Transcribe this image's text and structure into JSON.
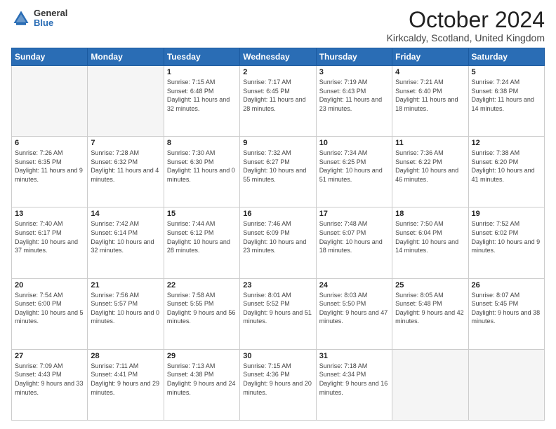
{
  "header": {
    "logo_general": "General",
    "logo_blue": "Blue",
    "title": "October 2024",
    "location": "Kirkcaldy, Scotland, United Kingdom"
  },
  "weekdays": [
    "Sunday",
    "Monday",
    "Tuesday",
    "Wednesday",
    "Thursday",
    "Friday",
    "Saturday"
  ],
  "weeks": [
    [
      {
        "day": "",
        "sunrise": "",
        "sunset": "",
        "daylight": ""
      },
      {
        "day": "",
        "sunrise": "",
        "sunset": "",
        "daylight": ""
      },
      {
        "day": "1",
        "sunrise": "Sunrise: 7:15 AM",
        "sunset": "Sunset: 6:48 PM",
        "daylight": "Daylight: 11 hours and 32 minutes."
      },
      {
        "day": "2",
        "sunrise": "Sunrise: 7:17 AM",
        "sunset": "Sunset: 6:45 PM",
        "daylight": "Daylight: 11 hours and 28 minutes."
      },
      {
        "day": "3",
        "sunrise": "Sunrise: 7:19 AM",
        "sunset": "Sunset: 6:43 PM",
        "daylight": "Daylight: 11 hours and 23 minutes."
      },
      {
        "day": "4",
        "sunrise": "Sunrise: 7:21 AM",
        "sunset": "Sunset: 6:40 PM",
        "daylight": "Daylight: 11 hours and 18 minutes."
      },
      {
        "day": "5",
        "sunrise": "Sunrise: 7:24 AM",
        "sunset": "Sunset: 6:38 PM",
        "daylight": "Daylight: 11 hours and 14 minutes."
      }
    ],
    [
      {
        "day": "6",
        "sunrise": "Sunrise: 7:26 AM",
        "sunset": "Sunset: 6:35 PM",
        "daylight": "Daylight: 11 hours and 9 minutes."
      },
      {
        "day": "7",
        "sunrise": "Sunrise: 7:28 AM",
        "sunset": "Sunset: 6:32 PM",
        "daylight": "Daylight: 11 hours and 4 minutes."
      },
      {
        "day": "8",
        "sunrise": "Sunrise: 7:30 AM",
        "sunset": "Sunset: 6:30 PM",
        "daylight": "Daylight: 11 hours and 0 minutes."
      },
      {
        "day": "9",
        "sunrise": "Sunrise: 7:32 AM",
        "sunset": "Sunset: 6:27 PM",
        "daylight": "Daylight: 10 hours and 55 minutes."
      },
      {
        "day": "10",
        "sunrise": "Sunrise: 7:34 AM",
        "sunset": "Sunset: 6:25 PM",
        "daylight": "Daylight: 10 hours and 51 minutes."
      },
      {
        "day": "11",
        "sunrise": "Sunrise: 7:36 AM",
        "sunset": "Sunset: 6:22 PM",
        "daylight": "Daylight: 10 hours and 46 minutes."
      },
      {
        "day": "12",
        "sunrise": "Sunrise: 7:38 AM",
        "sunset": "Sunset: 6:20 PM",
        "daylight": "Daylight: 10 hours and 41 minutes."
      }
    ],
    [
      {
        "day": "13",
        "sunrise": "Sunrise: 7:40 AM",
        "sunset": "Sunset: 6:17 PM",
        "daylight": "Daylight: 10 hours and 37 minutes."
      },
      {
        "day": "14",
        "sunrise": "Sunrise: 7:42 AM",
        "sunset": "Sunset: 6:14 PM",
        "daylight": "Daylight: 10 hours and 32 minutes."
      },
      {
        "day": "15",
        "sunrise": "Sunrise: 7:44 AM",
        "sunset": "Sunset: 6:12 PM",
        "daylight": "Daylight: 10 hours and 28 minutes."
      },
      {
        "day": "16",
        "sunrise": "Sunrise: 7:46 AM",
        "sunset": "Sunset: 6:09 PM",
        "daylight": "Daylight: 10 hours and 23 minutes."
      },
      {
        "day": "17",
        "sunrise": "Sunrise: 7:48 AM",
        "sunset": "Sunset: 6:07 PM",
        "daylight": "Daylight: 10 hours and 18 minutes."
      },
      {
        "day": "18",
        "sunrise": "Sunrise: 7:50 AM",
        "sunset": "Sunset: 6:04 PM",
        "daylight": "Daylight: 10 hours and 14 minutes."
      },
      {
        "day": "19",
        "sunrise": "Sunrise: 7:52 AM",
        "sunset": "Sunset: 6:02 PM",
        "daylight": "Daylight: 10 hours and 9 minutes."
      }
    ],
    [
      {
        "day": "20",
        "sunrise": "Sunrise: 7:54 AM",
        "sunset": "Sunset: 6:00 PM",
        "daylight": "Daylight: 10 hours and 5 minutes."
      },
      {
        "day": "21",
        "sunrise": "Sunrise: 7:56 AM",
        "sunset": "Sunset: 5:57 PM",
        "daylight": "Daylight: 10 hours and 0 minutes."
      },
      {
        "day": "22",
        "sunrise": "Sunrise: 7:58 AM",
        "sunset": "Sunset: 5:55 PM",
        "daylight": "Daylight: 9 hours and 56 minutes."
      },
      {
        "day": "23",
        "sunrise": "Sunrise: 8:01 AM",
        "sunset": "Sunset: 5:52 PM",
        "daylight": "Daylight: 9 hours and 51 minutes."
      },
      {
        "day": "24",
        "sunrise": "Sunrise: 8:03 AM",
        "sunset": "Sunset: 5:50 PM",
        "daylight": "Daylight: 9 hours and 47 minutes."
      },
      {
        "day": "25",
        "sunrise": "Sunrise: 8:05 AM",
        "sunset": "Sunset: 5:48 PM",
        "daylight": "Daylight: 9 hours and 42 minutes."
      },
      {
        "day": "26",
        "sunrise": "Sunrise: 8:07 AM",
        "sunset": "Sunset: 5:45 PM",
        "daylight": "Daylight: 9 hours and 38 minutes."
      }
    ],
    [
      {
        "day": "27",
        "sunrise": "Sunrise: 7:09 AM",
        "sunset": "Sunset: 4:43 PM",
        "daylight": "Daylight: 9 hours and 33 minutes."
      },
      {
        "day": "28",
        "sunrise": "Sunrise: 7:11 AM",
        "sunset": "Sunset: 4:41 PM",
        "daylight": "Daylight: 9 hours and 29 minutes."
      },
      {
        "day": "29",
        "sunrise": "Sunrise: 7:13 AM",
        "sunset": "Sunset: 4:38 PM",
        "daylight": "Daylight: 9 hours and 24 minutes."
      },
      {
        "day": "30",
        "sunrise": "Sunrise: 7:15 AM",
        "sunset": "Sunset: 4:36 PM",
        "daylight": "Daylight: 9 hours and 20 minutes."
      },
      {
        "day": "31",
        "sunrise": "Sunrise: 7:18 AM",
        "sunset": "Sunset: 4:34 PM",
        "daylight": "Daylight: 9 hours and 16 minutes."
      },
      {
        "day": "",
        "sunrise": "",
        "sunset": "",
        "daylight": ""
      },
      {
        "day": "",
        "sunrise": "",
        "sunset": "",
        "daylight": ""
      }
    ]
  ]
}
